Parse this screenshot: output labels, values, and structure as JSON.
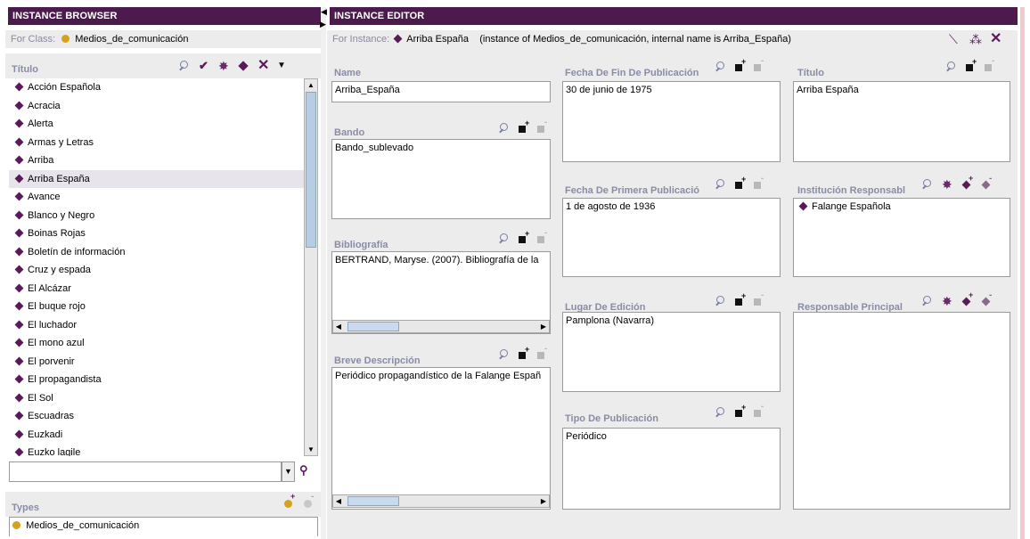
{
  "browser": {
    "title": "INSTANCE BROWSER",
    "for_class_label": "For Class:",
    "for_class_value": "Medios_de_comunicación",
    "list_header": "Título",
    "items": [
      "Acción Española",
      "Acracia",
      "Alerta",
      "Armas y Letras",
      "Arriba",
      "Arriba España",
      "Avance",
      "Blanco y Negro",
      "Boinas Rojas",
      "Boletín de información",
      "Cruz y espada",
      "El Alcázar",
      "El buque rojo",
      "El luchador",
      "El mono azul",
      "El porvenir",
      "El propagandista",
      "El Sol",
      "Escuadras",
      "Euzkadi",
      "Euzko lagile"
    ],
    "selected_index": 5,
    "search_value": "",
    "types_label": "Types",
    "types_items": [
      "Medios_de_comunicación"
    ]
  },
  "editor": {
    "title": "INSTANCE EDITOR",
    "for_instance_label": "For Instance:",
    "for_instance_value": "Arriba España",
    "for_instance_detail": "(instance of Medios_de_comunicación, internal name is Arriba_España)",
    "fields": {
      "name": {
        "label": "Name",
        "value": "Arriba_España"
      },
      "bando": {
        "label": "Bando",
        "value": "Bando_sublevado"
      },
      "bibliografia": {
        "label": "Bibliografía",
        "value": "BERTRAND, Maryse. (2007). Bibliografía de la"
      },
      "breve": {
        "label": "Breve Descripción",
        "value": "Periódico propagandístico de la Falange Españ"
      },
      "fecha_fin": {
        "label": "Fecha De Fin De Publicación",
        "value": "30 de junio de 1975"
      },
      "fecha_primera": {
        "label": "Fecha De Primera Publicació",
        "value": "1 de agosto de 1936"
      },
      "lugar": {
        "label": "Lugar De Edición",
        "value": "Pamplona (Navarra)"
      },
      "tipo": {
        "label": "Tipo De Publicación",
        "value": "Periódico"
      },
      "titulo": {
        "label": "Título",
        "value": "Arriba España"
      },
      "institucion": {
        "label": "Institución Responsabl",
        "value": "Falange Española"
      },
      "responsable": {
        "label": "Responsable Principal",
        "value": ""
      }
    }
  },
  "icons": {
    "search": "search-icon",
    "add": "add-value-icon",
    "remove": "remove-value-icon",
    "create_instance": "create-instance-icon",
    "delete": "delete-icon",
    "find": "binoculars-icon"
  },
  "colors": {
    "header_bg": "#4d1a4d",
    "label": "#8a8ca6",
    "instance_diamond": "#5a1a5a",
    "class_dot": "#d6a21c",
    "selection": "#e8e4ec"
  }
}
